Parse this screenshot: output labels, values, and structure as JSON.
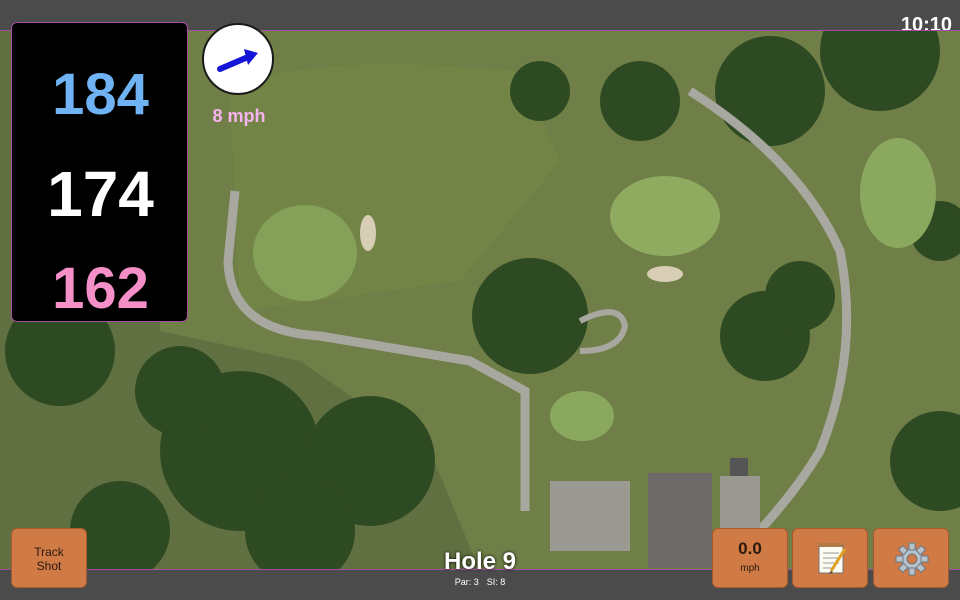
{
  "clock": "10:10",
  "distances": {
    "back": "184",
    "middle": "174",
    "front": "162"
  },
  "wind": {
    "speed": "8 mph",
    "direction_icon": "arrow-up-right-icon"
  },
  "buttons": {
    "track_shot_line1": "Track",
    "track_shot_line2": "Shot",
    "speed_value": "0.0",
    "speed_unit": "mph",
    "notes_icon": "notepad-icon",
    "settings_icon": "gear-icon"
  },
  "hole": {
    "title": "Hole 9",
    "par": "Par: 3",
    "si": "SI: 8"
  },
  "colors": {
    "back": "#6fb3f5",
    "middle": "#ffffff",
    "front": "#f58fc8",
    "accent": "#a64da0",
    "button": "#d07a45"
  }
}
